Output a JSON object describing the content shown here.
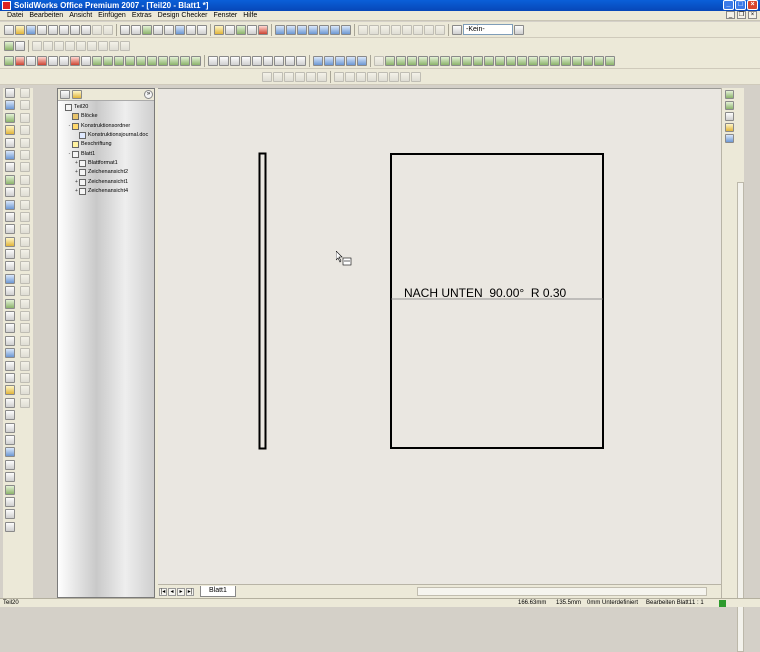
{
  "app": {
    "title": "SolidWorks Office Premium 2007 - [Teil20 - Blatt1 *]"
  },
  "menu": [
    "Datei",
    "Bearbeiten",
    "Ansicht",
    "Einfügen",
    "Extras",
    "Design Checker",
    "Fenster",
    "Hilfe"
  ],
  "toolbar": {
    "layer_combo": "-Kein-"
  },
  "tree": {
    "items": [
      {
        "label": "Teil20",
        "indent": 0,
        "icon": "drawing-icon",
        "twisty": ""
      },
      {
        "label": "Blöcke",
        "indent": 1,
        "icon": "book-icon",
        "twisty": ""
      },
      {
        "label": "Konstruktionsordner",
        "indent": 1,
        "icon": "folder-icon",
        "twisty": "-"
      },
      {
        "label": "Konstruktionsjournal.doc",
        "indent": 2,
        "icon": "doc-icon",
        "twisty": ""
      },
      {
        "label": "Beschriftung",
        "indent": 1,
        "icon": "annotation-icon",
        "twisty": ""
      },
      {
        "label": "Blatt1",
        "indent": 1,
        "icon": "sheet-icon",
        "twisty": "-"
      },
      {
        "label": "Blattformat1",
        "indent": 2,
        "icon": "sheetformat-icon",
        "twisty": "+"
      },
      {
        "label": "Zeichenansicht2",
        "indent": 2,
        "icon": "drawingview-icon",
        "twisty": "+"
      },
      {
        "label": "Zeichenansicht1",
        "indent": 2,
        "icon": "drawingview-icon",
        "twisty": "+"
      },
      {
        "label": "Zeichenansicht4",
        "indent": 2,
        "icon": "drawingview-icon",
        "twisty": "+"
      }
    ]
  },
  "drawing": {
    "annotation": "NACH UNTEN  90.00°  R 0.30"
  },
  "sheet_tab": "Blatt1",
  "statusbar": {
    "doc": "Teil20",
    "x": "166.63mm",
    "y": "135.5mm",
    "z": "0mm",
    "state": "Unterdefiniert",
    "edit": "Bearbeiten Blatt1",
    "scale": "1 : 1"
  }
}
